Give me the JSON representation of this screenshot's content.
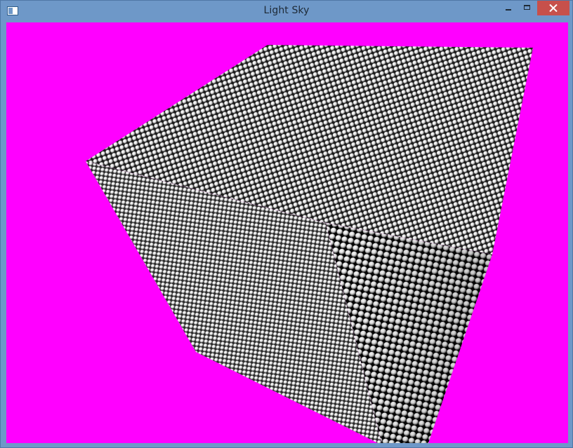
{
  "window": {
    "title": "Light Sky",
    "icons": {
      "app": "app-window-icon",
      "minimize": "minimize-icon",
      "maximize": "maximize-icon",
      "close": "close-icon"
    }
  },
  "colors": {
    "background": "#ff00ff",
    "titlebar": "#6e98c8",
    "close_button": "#c7504b",
    "sphere_light": "#ffffff",
    "sphere_dark": "#000000"
  }
}
